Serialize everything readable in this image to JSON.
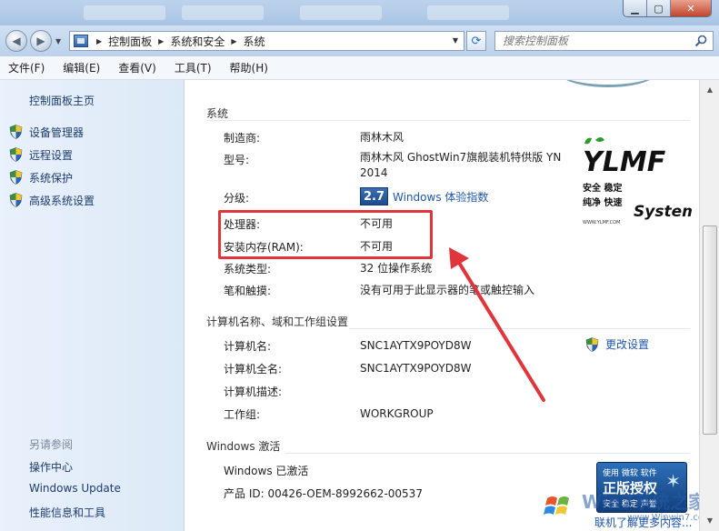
{
  "address": {
    "crumbs": [
      "控制面板",
      "系统和安全",
      "系统"
    ],
    "search_placeholder": "搜索控制面板"
  },
  "menu": [
    "文件(F)",
    "编辑(E)",
    "查看(V)",
    "工具(T)",
    "帮助(H)"
  ],
  "sidebar": {
    "home": "控制面板主页",
    "links": [
      "设备管理器",
      "远程设置",
      "系统保护",
      "高级系统设置"
    ],
    "see_also_title": "另请参阅",
    "see_also": [
      "操作中心",
      "Windows Update",
      "性能信息和工具"
    ]
  },
  "system": {
    "section_title": "系统",
    "rows": [
      {
        "label": "制造商:",
        "value": "雨林木风"
      },
      {
        "label": "型号:",
        "value": "雨林木风 GhostWin7旗舰装机特供版 YN 2014"
      },
      {
        "label": "分级:",
        "value": ""
      },
      {
        "label": "处理器:",
        "value": "不可用"
      },
      {
        "label": "安装内存(RAM):",
        "value": "不可用"
      },
      {
        "label": "系统类型:",
        "value": "32 位操作系统"
      },
      {
        "label": "笔和触摸:",
        "value": "没有可用于此显示器的笔或触控输入"
      }
    ],
    "rating_score": "2.7",
    "rating_link": "Windows 体验指数"
  },
  "computer": {
    "section_title": "计算机名称、域和工作组设置",
    "rows": [
      {
        "label": "计算机名:",
        "value": "SNC1AYTX9POYD8W"
      },
      {
        "label": "计算机全名:",
        "value": "SNC1AYTX9POYD8W"
      },
      {
        "label": "计算机描述:",
        "value": ""
      },
      {
        "label": "工作组:",
        "value": "WORKGROUP"
      }
    ],
    "change_link": "更改设置"
  },
  "activation": {
    "section_title": "Windows 激活",
    "status": "Windows 已激活",
    "product_id": "产品 ID: 00426-OEM-8992662-00537"
  },
  "logo": {
    "brand": "YLMF",
    "line1": "安全 稳定",
    "line2": "纯净 快速",
    "site": "WWW.YLMF.COM",
    "system_word": "System"
  },
  "genuine": {
    "line1": "使用 微软 软件",
    "line2": "正版授权",
    "line3": "安全 稳定 声誉",
    "learn_more": "联机了解更多内容..."
  },
  "watermark": {
    "text": "Win7系统之家",
    "url": "www.Winwin7.com"
  },
  "colors": {
    "highlight_red": "#e0353a",
    "link_blue": "#1f56a8",
    "sidebar_bg": "#e9f1fb"
  }
}
